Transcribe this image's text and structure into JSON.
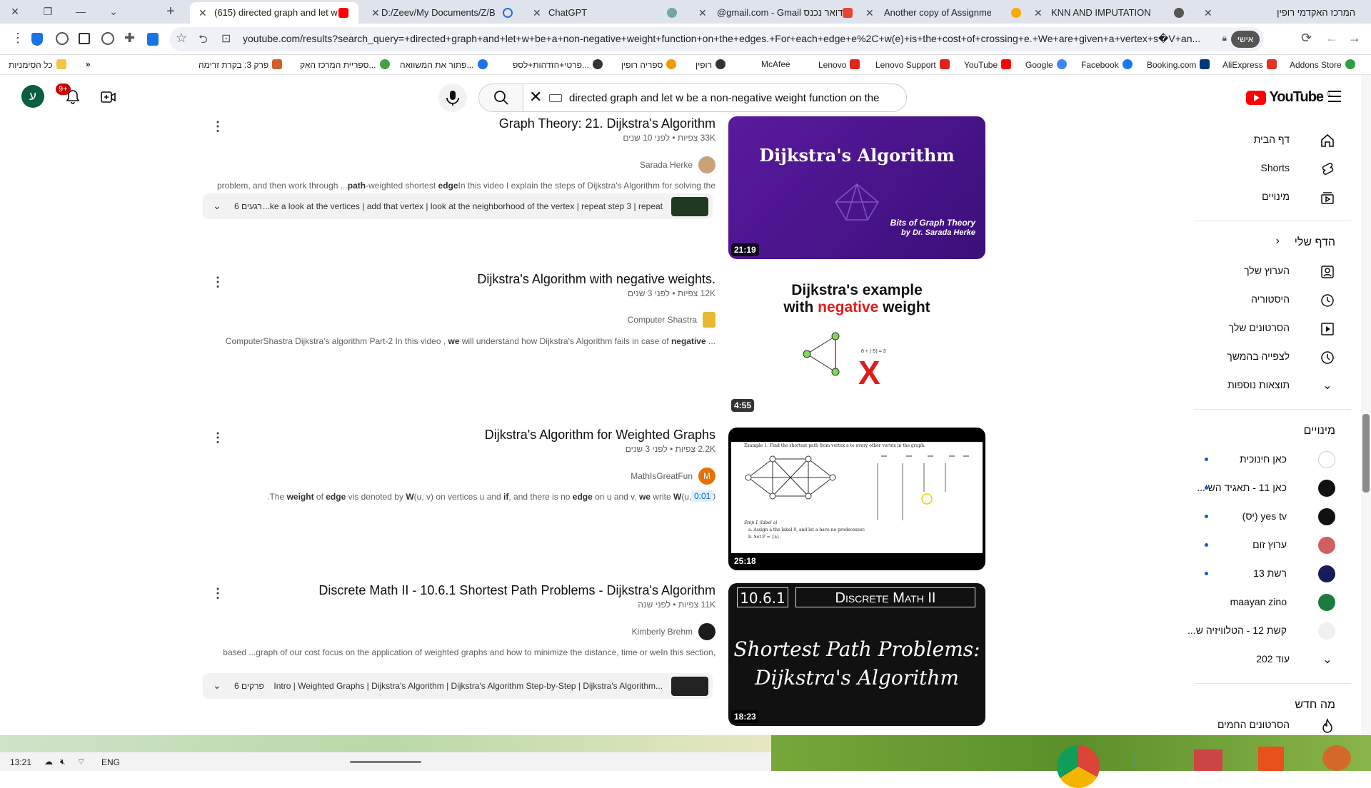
{
  "browser": {
    "tabs": [
      {
        "title": "(615) directed graph and let w",
        "active": true
      },
      {
        "title": "D:/Zeev/My Documents/Z/BOO"
      },
      {
        "title": "ChatGPT"
      },
      {
        "title": "@gmail.com - Gmail דואר נכנס"
      },
      {
        "title": "Another copy of Assignment_4"
      },
      {
        "title": "KNN AND IMPUTATION"
      },
      {
        "title": "המרכז האקדמי רופין"
      }
    ],
    "url": "youtube.com/results?search_query=+directed+graph+and+let+w+be+a+non-negative+weight+function+on+the+edges.+For+each+edge+e%2C+w(e)+is+the+cost+of+crossing+e.+We+are+given+a+vertex+s�V+an...",
    "profile_badge": "אישי",
    "bookmarks": [
      "כל הסימניות",
      "פרק 3: בקרת זרימה",
      "ספריית המרכז האק...",
      "פתור את המשוואה...",
      "פרטי+הזדהות+לספ...",
      "ספריה רופין",
      "רופין",
      "McAfee",
      "Lenovo",
      "Lenovo Support",
      "YouTube",
      "Google",
      "Facebook",
      "Booking.com",
      "AliExpress",
      "Addons Store"
    ]
  },
  "youtube": {
    "logo": "YouTube",
    "logo_country": "IL",
    "search_query": "directed graph and let w be a non-negative weight function on the",
    "notifications": "9+",
    "avatar_letter": "ע",
    "sidebar": {
      "main": [
        {
          "label": "דף הבית",
          "icon": "home-icon"
        },
        {
          "label": "Shorts",
          "icon": "shorts-icon"
        },
        {
          "label": "מינויים",
          "icon": "subscriptions-icon"
        }
      ],
      "you_header": "הדף שלי",
      "you": [
        {
          "label": "הערוץ שלך",
          "icon": "channel-icon"
        },
        {
          "label": "היסטוריה",
          "icon": "history-icon"
        },
        {
          "label": "הסרטונים שלך",
          "icon": "your-videos-icon"
        },
        {
          "label": "לצפייה בהמשך",
          "icon": "watch-later-icon"
        },
        {
          "label": "תוצאות נוספות",
          "icon": "chevron-down-icon"
        }
      ],
      "subs_header": "מינויים",
      "subs": [
        {
          "label": "כאן חינוכית",
          "color": "#ffffff",
          "dot": true
        },
        {
          "label": "כאן 11 - תאגיד השי...",
          "color": "#111111",
          "dot": true
        },
        {
          "label": "yes tv (יס)",
          "color": "#111111",
          "dot": true
        },
        {
          "label": "ערוץ זום",
          "color": "#d06060",
          "dot": true
        },
        {
          "label": "רשת 13",
          "color": "#1a1a5e",
          "dot": true
        },
        {
          "label": "maayan zino",
          "color": "#1e7a3e",
          "dot": false
        },
        {
          "label": "קשת 12 - הטלוויזיה ש...",
          "color": "#f0f0f0",
          "dot": false
        }
      ],
      "more": "עוד 202",
      "explore_header": "מה חדש",
      "explore": [
        {
          "label": "הסרטונים החמים",
          "icon": "trending-icon"
        }
      ]
    },
    "results": [
      {
        "title": "Graph Theory: 21. Dijkstra's Algorithm",
        "views": "33K צפיות",
        "age": "לפני 10 שנים",
        "channel": "Sarada Herke",
        "channel_color": "#c9a27a",
        "description_parts": [
          "problem, and then work through ...",
          "path",
          "-weighted shortest ",
          "edge",
          "In this video I explain the steps of Dijkstra's Algorithm for solving the"
        ],
        "duration": "21:19",
        "thumb_title": "Dijkstra's Algorithm",
        "thumb_sub1": "Bits of Graph Theory",
        "thumb_sub2": "by Dr. Sarada Herke",
        "chapters_count": "6 רגעים",
        "chapters_text": "...ke a look at the vertices | add that vertex | look at the neighborhood of the vertex | repeat step 3 | repeat"
      },
      {
        "title": "Dijkstra's Algorithm with negative weights.",
        "views": "12K צפיות",
        "age": "לפני 3 שנים",
        "channel": "Computer Shastra",
        "channel_color": "#e8b830",
        "description_parts": [
          "ComputerShastra Dijkstra's algorithm Part-2 In this video , ",
          "we",
          " will understand how Dijkstra's Algorithm fails in case of ",
          "negative",
          " ..."
        ],
        "duration": "4:55",
        "thumb_line1": "Dijkstra's example",
        "thumb_line2a": "with ",
        "thumb_line2b": "negative",
        "thumb_line2c": " weight",
        "thumb_eq": "8 + (-5) = 3",
        "thumb_x": "X"
      },
      {
        "title": "Dijkstra's Algorithm for Weighted Graphs",
        "views": "2.2K צפיות",
        "age": "לפני 3 שנים",
        "channel": "MathIsGreatFun",
        "channel_letter": "M",
        "channel_color": "#e8710a",
        "description_parts": [
          "The ",
          "weight",
          " of ",
          "edge",
          " vis denoted by ",
          "W",
          "(u, v) on vertices u and ",
          "if",
          ", and there is no ",
          "edge",
          " on u and v, ",
          "we",
          " write ",
          "W",
          "(u, v) = 0."
        ],
        "timestamp": "0:01",
        "duration": "25:18",
        "thumb_header": "Example 1: Find the shortest path from vertex a to every other vertex in the graph.",
        "thumb_step": "Step 1 (label a)",
        "thumb_step_a": "a.  Assign a the label 0, and let a have no predecessor.",
        "thumb_step_b": "b.  Set P = {a}."
      },
      {
        "title": "Discrete Math II - 10.6.1 Shortest Path Problems - Dijkstra's Algorithm",
        "views": "11K צפיות",
        "age": "לפני שנה",
        "channel": "Kimberly Brehm",
        "channel_color": "#1b1b1b",
        "description_parts": [
          "In this section, ",
          "we",
          " focus on the application of weighted ",
          "graph",
          "s and how to minimize the distance, time or ",
          "cost",
          " of our ",
          "graph",
          " ..."
        ],
        "desc_text_rtl": "based ...graph of our cost focus on the application of weighted graphs and how to minimize the distance, time or weIn this section,",
        "duration": "18:23",
        "thumb_num": "10.6.1",
        "thumb_course": "Discrete Math II",
        "thumb_l1": "Shortest Path Problems:",
        "thumb_l2": "Dijkstra's Algorithm",
        "chapters_count": "6 פרקים",
        "chapters_text": "Intro | Weighted Graphs | Dijkstra's Algorithm | Dijkstra's Algorithm Step-by-Step | Dijkstra's Algorithm..."
      }
    ]
  },
  "taskbar": {
    "time": "13:21",
    "lang": "ENG"
  }
}
